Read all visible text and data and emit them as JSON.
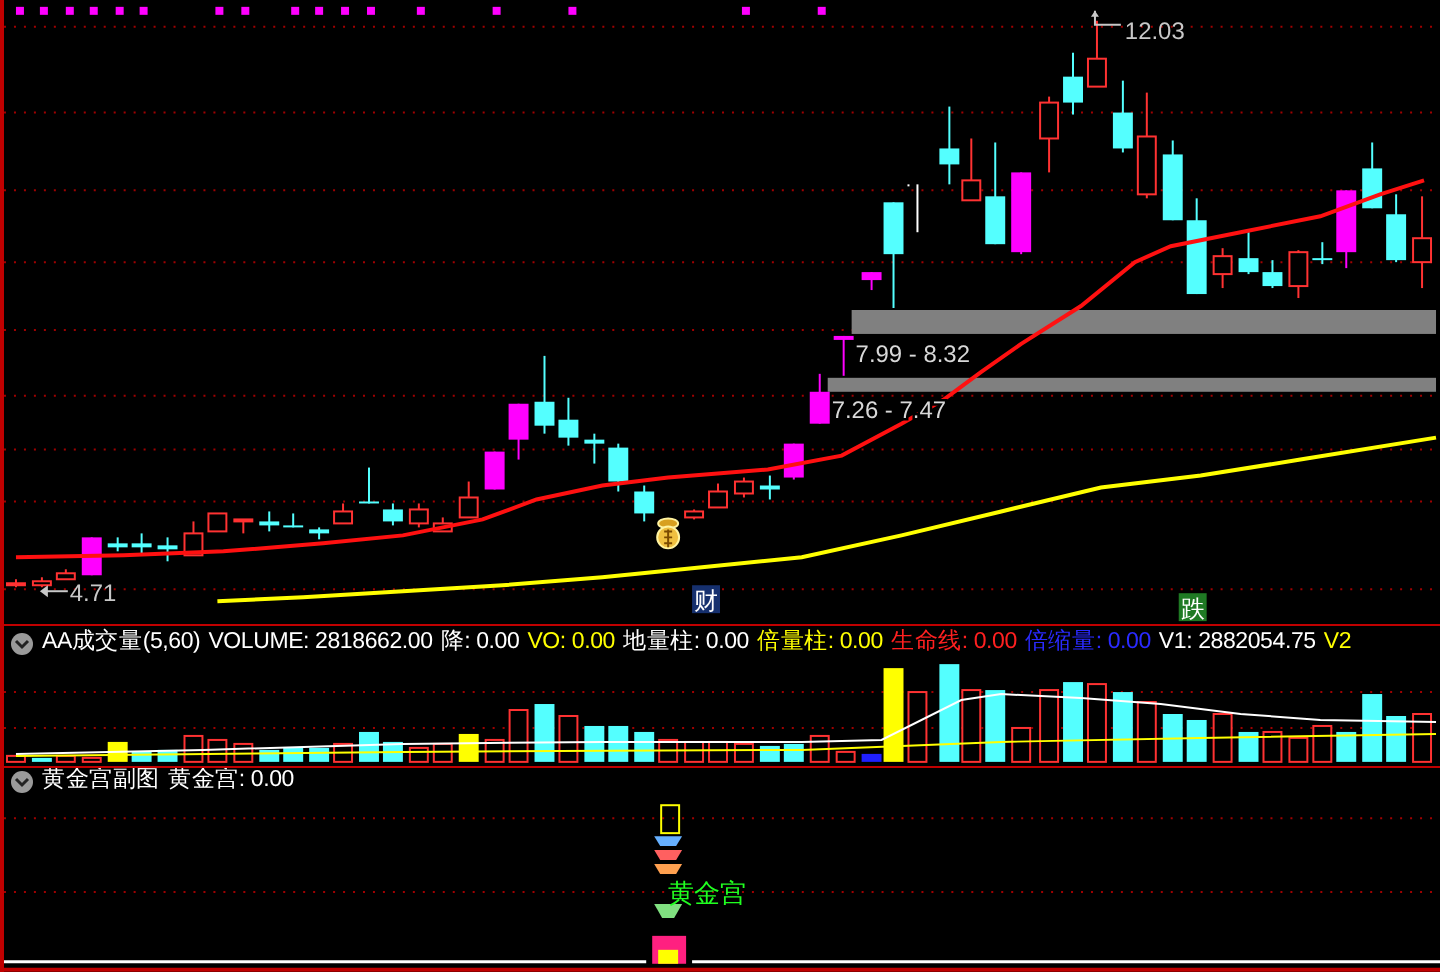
{
  "main_chart": {
    "high_label": "12.03",
    "low_label": "4.71",
    "zones": [
      {
        "label": "7.99 - 8.32"
      },
      {
        "label": "7.26 - 7.47"
      }
    ],
    "markers": [
      {
        "text": "财",
        "color": "#16306e"
      },
      {
        "text": "跌",
        "color": "#1f7a24"
      }
    ]
  },
  "volume_panel": {
    "title": "AA成交量(5,60)",
    "fields": [
      {
        "text": "VOLUME: 2818662.00",
        "color": "#ffffff"
      },
      {
        "text": "降: 0.00",
        "color": "#ffffff"
      },
      {
        "text": "VO: 0.00",
        "color": "#ffff00"
      },
      {
        "text": "地量柱: 0.00",
        "color": "#ffffff"
      },
      {
        "text": "倍量柱: 0.00",
        "color": "#ffff00"
      },
      {
        "text": "生命线: 0.00",
        "color": "#ff2020"
      },
      {
        "text": "倍缩量: 0.00",
        "color": "#2a2aff"
      },
      {
        "text": "V1: 2882054.75",
        "color": "#ffffff"
      },
      {
        "text": "V2",
        "color": "#ffff00"
      }
    ]
  },
  "gold_panel": {
    "title": "黄金宫副图",
    "fields": [
      {
        "text": "黄金宫: 0.00",
        "color": "#ffffff"
      }
    ],
    "signal_label": "黄金宫"
  }
}
